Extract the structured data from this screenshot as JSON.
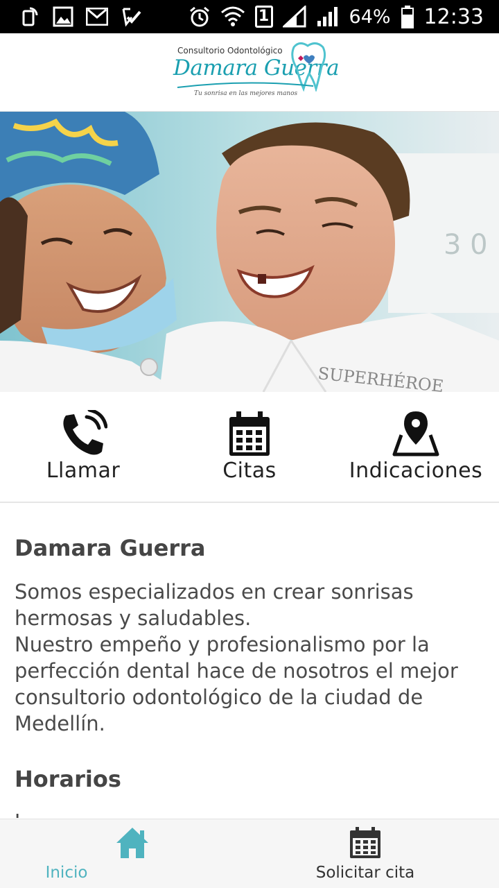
{
  "status_bar": {
    "battery": "64%",
    "sim_slot": "1",
    "time": "12:33"
  },
  "header": {
    "logo": {
      "top_line": "Consultorio Odontológico",
      "name": "Damara Guerra",
      "tagline": "Tu sonrisa en las mejores manos"
    }
  },
  "hero": {
    "shirt_text": "SUPERHÉROE"
  },
  "actions": [
    {
      "label": "Llamar",
      "icon": "phone-icon"
    },
    {
      "label": "Citas",
      "icon": "calendar-icon"
    },
    {
      "label": "Indicaciones",
      "icon": "map-pin-icon"
    }
  ],
  "content": {
    "title": "Damara Guerra",
    "description": "Somos especializados en crear sonrisas\nhermosas y saludables.\nNuestro empeño y profesionalismo por la\nperfección dental hace de nosotros el mejor\nconsultorio odontológico de la ciudad de\nMedellín.",
    "hours_title": "Horarios",
    "cut_text": "L"
  },
  "bottom_nav": [
    {
      "label": "Inicio",
      "icon": "home-icon",
      "active": true
    },
    {
      "label": "Solicitar cita",
      "icon": "calendar-icon",
      "active": false
    }
  ],
  "colors": {
    "accent": "#4fb3bf",
    "text_dark": "#454545",
    "nav_inactive": "#333333",
    "logo_teal": "#1a9fb0"
  }
}
